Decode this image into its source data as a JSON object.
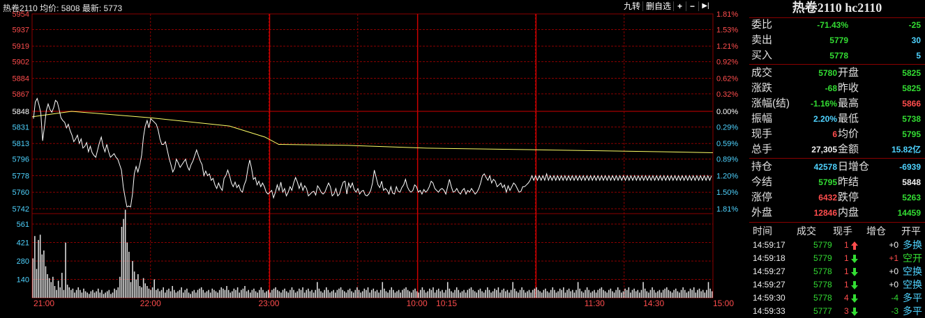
{
  "header": {
    "title": "热卷2110 均价: 5808 最新: 5773",
    "btn_nine": "九转",
    "btn_delete": "删自选",
    "btn_plus": "+",
    "btn_minus": "−",
    "btn_next": "▶|"
  },
  "colors": {
    "red": "#ff4d4d",
    "green": "#33dd33",
    "cyan": "#4fd3ff",
    "grid": "#8b0000",
    "avg": "#ffff66",
    "price": "#ffffff"
  },
  "chart_data": {
    "type": "line",
    "price_axis": {
      "ticks": [
        5954,
        5937,
        5919,
        5902,
        5884,
        5867,
        5848,
        5831,
        5813,
        5796,
        5778,
        5760,
        5742
      ],
      "pct_ticks": [
        "1.81%",
        "1.53%",
        "1.21%",
        "0.92%",
        "0.62%",
        "0.32%",
        "0.00%",
        "0.29%",
        "0.59%",
        "0.89%",
        "1.20%",
        "1.50%",
        "1.81%"
      ],
      "ylim": [
        5742,
        5954
      ],
      "ref": 5848
    },
    "volume_axis": {
      "ticks": [
        561,
        421,
        280,
        140
      ],
      "ylim": [
        0,
        561
      ]
    },
    "time_labels": [
      "21:00",
      "22:00",
      "23:00",
      "10:00",
      "10:15",
      "11:30",
      "14:30",
      "15:00"
    ],
    "sessions": [
      {
        "start": "21:00",
        "end": "23:00",
        "minutes": 120
      },
      {
        "start": "09:00",
        "end": "10:15",
        "minutes": 75
      },
      {
        "start": "10:30",
        "end": "11:30",
        "minutes": 60
      },
      {
        "start": "13:30",
        "end": "15:00",
        "minutes": 90
      }
    ],
    "price": [
      5840,
      5858,
      5862,
      5855,
      5846,
      5816,
      5832,
      5849,
      5856,
      5850,
      5847,
      5852,
      5860,
      5858,
      5850,
      5841,
      5838,
      5836,
      5830,
      5834,
      5827,
      5822,
      5815,
      5818,
      5822,
      5813,
      5818,
      5808,
      5810,
      5814,
      5804,
      5810,
      5803,
      5800,
      5798,
      5806,
      5814,
      5820,
      5810,
      5804,
      5812,
      5804,
      5798,
      5800,
      5802,
      5798,
      5796,
      5790,
      5784,
      5766,
      5754,
      5744,
      5745,
      5744,
      5758,
      5780,
      5788,
      5782,
      5790,
      5800,
      5820,
      5832,
      5838,
      5830,
      5840,
      5838,
      5836,
      5834,
      5828,
      5818,
      5812,
      5812,
      5815,
      5806,
      5797,
      5790,
      5782,
      5786,
      5796,
      5792,
      5787,
      5790,
      5793,
      5796,
      5788,
      5784,
      5790,
      5794,
      5800,
      5806,
      5800,
      5794,
      5790,
      5778,
      5783,
      5778,
      5780,
      5773,
      5775,
      5768,
      5764,
      5770,
      5765,
      5762,
      5775,
      5778,
      5784,
      5778,
      5770,
      5766,
      5771,
      5765,
      5768,
      5762,
      5760,
      5768,
      5773,
      5786,
      5795,
      5786,
      5774,
      5776,
      5768,
      5772,
      5766,
      5770,
      5766,
      5760,
      5758,
      5760,
      5762,
      5754,
      5760,
      5768,
      5762,
      5771,
      5760,
      5764,
      5756,
      5760,
      5766,
      5762,
      5770,
      5776,
      5771,
      5764,
      5770,
      5762,
      5767,
      5764,
      5756,
      5758,
      5760,
      5761,
      5757,
      5767,
      5764,
      5760,
      5758,
      5760,
      5765,
      5770,
      5766,
      5756,
      5758,
      5764,
      5756,
      5758,
      5765,
      5771,
      5772,
      5758,
      5770,
      5765,
      5770,
      5763,
      5760,
      5764,
      5758,
      5761,
      5762,
      5757,
      5756,
      5758,
      5762,
      5770,
      5784,
      5776,
      5768,
      5765,
      5772,
      5762,
      5764,
      5762,
      5758,
      5766,
      5759,
      5758,
      5766,
      5761,
      5760,
      5765,
      5768,
      5774,
      5766,
      5762,
      5760,
      5762,
      5768,
      5766,
      5760,
      5762,
      5758,
      5763,
      5760,
      5762,
      5766,
      5772,
      5770,
      5764,
      5762,
      5760,
      5763,
      5764,
      5762,
      5758,
      5766,
      5774,
      5766,
      5760,
      5761,
      5764,
      5760,
      5758,
      5762,
      5764,
      5758,
      5762,
      5760,
      5764,
      5761,
      5758,
      5760,
      5764,
      5770,
      5778,
      5780,
      5776,
      5773,
      5778,
      5770,
      5774,
      5772,
      5766,
      5768,
      5770,
      5765,
      5768,
      5760,
      5767,
      5762,
      5766,
      5770,
      5768,
      5764,
      5760,
      5761,
      5766,
      5766,
      5768,
      5770,
      5773,
      5778,
      5773,
      5778,
      5773,
      5778,
      5773,
      5778,
      5773,
      5780,
      5773,
      5778,
      5773,
      5778,
      5773,
      5778,
      5773,
      5778,
      5773,
      5778,
      5773,
      5778,
      5773,
      5778,
      5773,
      5778,
      5773,
      5778,
      5773,
      5778,
      5773,
      5778,
      5773,
      5778,
      5773,
      5778,
      5773,
      5778,
      5773,
      5778,
      5773,
      5778,
      5773,
      5778,
      5773,
      5778,
      5773,
      5778,
      5773,
      5778,
      5773,
      5778,
      5773,
      5778,
      5773,
      5778,
      5773,
      5778,
      5773,
      5778,
      5773,
      5778,
      5773,
      5778,
      5773,
      5778,
      5773,
      5778,
      5773,
      5778,
      5773,
      5778,
      5773,
      5778,
      5773,
      5778,
      5773,
      5778,
      5773,
      5778,
      5773,
      5778,
      5773,
      5778,
      5773,
      5778,
      5773,
      5778,
      5773,
      5778,
      5773,
      5778,
      5773,
      5778,
      5773,
      5778,
      5773,
      5778,
      5773,
      5778
    ],
    "avg_keypoints": [
      [
        0,
        5842
      ],
      [
        20,
        5848
      ],
      [
        60,
        5841
      ],
      [
        100,
        5832
      ],
      [
        118,
        5820
      ],
      [
        125,
        5812
      ],
      [
        160,
        5811
      ],
      [
        200,
        5808
      ],
      [
        260,
        5806
      ],
      [
        320,
        5804
      ],
      [
        345,
        5803
      ]
    ],
    "volume": [
      300,
      470,
      220,
      440,
      480,
      330,
      360,
      240,
      180,
      150,
      120,
      160,
      90,
      60,
      130,
      80,
      190,
      60,
      420,
      100,
      80,
      60,
      70,
      40,
      60,
      80,
      60,
      40,
      70,
      50,
      40,
      30,
      50,
      60,
      40,
      50,
      70,
      40,
      60,
      30,
      40,
      50,
      60,
      30,
      40,
      70,
      60,
      80,
      160,
      540,
      600,
      670,
      420,
      350,
      120,
      280,
      200,
      140,
      180,
      90,
      80,
      150,
      110,
      90,
      70,
      60,
      80,
      140,
      60,
      70,
      50,
      60,
      80,
      40,
      60,
      70,
      50,
      90,
      60,
      40,
      50,
      60,
      80,
      40,
      60,
      70,
      40,
      30,
      50,
      60,
      40,
      60,
      70,
      80,
      60,
      40,
      50,
      60,
      40,
      70,
      60,
      50,
      40,
      60,
      80,
      70,
      60,
      90,
      60,
      40,
      50,
      70,
      60,
      80,
      40,
      60,
      70,
      90,
      50,
      60,
      40,
      60,
      70,
      50,
      40,
      60,
      80,
      60,
      40,
      50,
      60,
      40,
      60,
      70,
      80,
      60,
      50,
      40,
      60,
      70,
      50,
      40,
      60,
      80,
      60,
      40,
      50,
      70,
      60,
      80,
      40,
      60,
      70,
      50,
      60,
      40,
      60,
      120,
      70,
      50,
      40,
      60,
      80,
      60,
      40,
      50,
      60,
      40,
      60,
      70,
      80,
      60,
      50,
      40,
      60,
      70,
      50,
      40,
      60,
      80,
      60,
      40,
      50,
      70,
      60,
      80,
      40,
      60,
      70,
      50,
      60,
      40,
      60,
      120,
      70,
      50,
      40,
      60,
      80,
      60,
      40,
      50,
      60,
      40,
      60,
      70,
      80,
      60,
      50,
      40,
      60,
      70,
      50,
      40,
      60,
      80,
      60,
      40,
      50,
      70,
      60,
      80,
      40,
      60,
      70,
      50,
      60,
      40,
      60,
      120,
      70,
      50,
      40,
      60,
      80,
      60,
      40,
      50,
      60,
      40,
      60,
      70,
      80,
      60,
      50,
      40,
      60,
      70,
      50,
      40,
      60,
      80,
      60,
      40,
      50,
      70,
      60,
      80,
      40,
      60,
      70,
      50,
      60,
      40,
      60,
      120,
      70,
      50,
      40,
      60,
      80,
      60,
      40,
      50,
      60,
      40,
      60,
      70,
      80,
      60,
      50,
      40,
      60,
      70,
      50,
      40,
      60,
      80,
      60,
      40,
      50,
      70,
      60,
      80,
      40,
      60,
      70,
      50,
      60,
      40,
      60,
      120,
      70,
      50,
      40,
      60,
      80,
      60,
      40,
      50,
      60,
      40,
      60,
      70,
      80,
      60,
      50,
      40,
      60,
      70,
      50,
      40,
      60,
      80,
      60,
      40,
      50,
      70,
      60,
      80,
      40,
      60,
      70,
      50,
      60,
      40,
      60,
      120,
      70,
      50,
      40,
      60,
      80,
      60,
      40,
      50,
      60,
      40,
      60,
      70,
      80,
      60,
      50,
      40,
      60,
      70,
      50,
      40,
      60,
      80,
      60,
      40,
      50,
      70,
      60,
      80,
      40,
      60,
      70,
      50,
      60,
      40,
      60,
      120,
      70,
      50
    ]
  },
  "panel": {
    "title": "热卷2110 hc2110",
    "rows_a": [
      {
        "label": "委比",
        "v1": "-71.43%",
        "c1": "green",
        "v2": "-25",
        "c2": "green"
      },
      {
        "label": "卖出",
        "v1": "5779",
        "c1": "green",
        "v2": "30",
        "c2": "cyan"
      },
      {
        "label": "买入",
        "v1": "5778",
        "c1": "green",
        "v2": "5",
        "c2": "cyan"
      }
    ],
    "rows_b": [
      {
        "l1": "成交",
        "v1": "5780",
        "c1": "green",
        "l2": "开盘",
        "v2": "5825",
        "c2": "green"
      },
      {
        "l1": "涨跌",
        "v1": "-68",
        "c1": "green",
        "l2": "昨收",
        "v2": "5825",
        "c2": "green"
      },
      {
        "l1": "涨幅(结)",
        "v1": "-1.16%",
        "c1": "green",
        "l2": "最高",
        "v2": "5866",
        "c2": "red"
      },
      {
        "l1": "振幅",
        "v1": "2.20%",
        "c1": "cyan",
        "l2": "最低",
        "v2": "5738",
        "c2": "green"
      },
      {
        "l1": "现手",
        "v1": "6",
        "c1": "red",
        "l2": "均价",
        "v2": "5795",
        "c2": "green"
      },
      {
        "l1": "总手",
        "v1": "27,305",
        "c1": "white",
        "l2": "金额",
        "v2": "15.82亿",
        "c2": "cyan"
      }
    ],
    "rows_c": [
      {
        "l1": "持仓",
        "v1": "42578",
        "c1": "cyan",
        "l2": "日增仓",
        "v2": "-6939",
        "c2": "cyan"
      },
      {
        "l1": "今结",
        "v1": "5795",
        "c1": "green",
        "l2": "昨结",
        "v2": "5848",
        "c2": "white"
      },
      {
        "l1": "涨停",
        "v1": "6432",
        "c1": "red",
        "l2": "跌停",
        "v2": "5263",
        "c2": "green"
      },
      {
        "l1": "外盘",
        "v1": "12846",
        "c1": "red",
        "l2": "内盘",
        "v2": "14459",
        "c2": "green"
      }
    ],
    "tick_headers": [
      "时间",
      "成交",
      "现手",
      "增仓",
      "开平"
    ],
    "ticks": [
      {
        "time": "14:59:17",
        "price": "5779",
        "qty": "1",
        "dir": "up",
        "oi": "+0",
        "type": "多换",
        "tcolor": "cyan"
      },
      {
        "time": "14:59:18",
        "price": "5779",
        "qty": "1",
        "dir": "down",
        "oi": "+1",
        "type": "空开",
        "tcolor": "green"
      },
      {
        "time": "14:59:27",
        "price": "5778",
        "qty": "1",
        "dir": "down",
        "oi": "+0",
        "type": "空换",
        "tcolor": "cyan"
      },
      {
        "time": "14:59:27",
        "price": "5778",
        "qty": "1",
        "dir": "down",
        "oi": "+0",
        "type": "空换",
        "tcolor": "cyan"
      },
      {
        "time": "14:59:30",
        "price": "5778",
        "qty": "4",
        "dir": "down",
        "oi": "-4",
        "type": "多平",
        "tcolor": "cyan"
      },
      {
        "time": "14:59:33",
        "price": "5777",
        "qty": "3",
        "dir": "down",
        "oi": "-3",
        "type": "多平",
        "tcolor": "cyan"
      }
    ]
  }
}
